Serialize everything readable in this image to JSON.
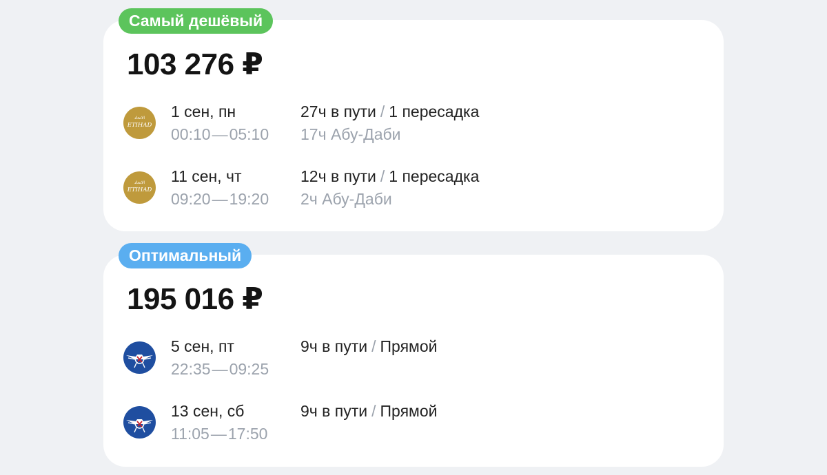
{
  "offers": [
    {
      "badge": "Самый дешёвый",
      "badge_color": "#5cc45c",
      "price": "103 276 ₽",
      "flights": [
        {
          "airline_icon": "etihad-logo",
          "date": "1 сен, пн",
          "depart": "00:10",
          "arrive": "05:10",
          "duration": "27ч в пути",
          "stops": "1 пересадка",
          "layover": "17ч Абу-Даби"
        },
        {
          "airline_icon": "etihad-logo",
          "date": "11 сен, чт",
          "depart": "09:20",
          "arrive": "19:20",
          "duration": "12ч в пути",
          "stops": "1 пересадка",
          "layover": "2ч Абу-Даби"
        }
      ]
    },
    {
      "badge": "Оптимальный",
      "badge_color": "#5aaef0",
      "price": "195 016 ₽",
      "flights": [
        {
          "airline_icon": "aeroflot-logo",
          "date": "5 сен, пт",
          "depart": "22:35",
          "arrive": "09:25",
          "duration": "9ч в пути",
          "stops": "Прямой",
          "layover": ""
        },
        {
          "airline_icon": "aeroflot-logo",
          "date": "13 сен, сб",
          "depart": "11:05",
          "arrive": "17:50",
          "duration": "9ч в пути",
          "stops": "Прямой",
          "layover": ""
        }
      ]
    }
  ],
  "time_separator": "—",
  "stops_separator": "/",
  "etihad_logo_text": "ETIHAD"
}
